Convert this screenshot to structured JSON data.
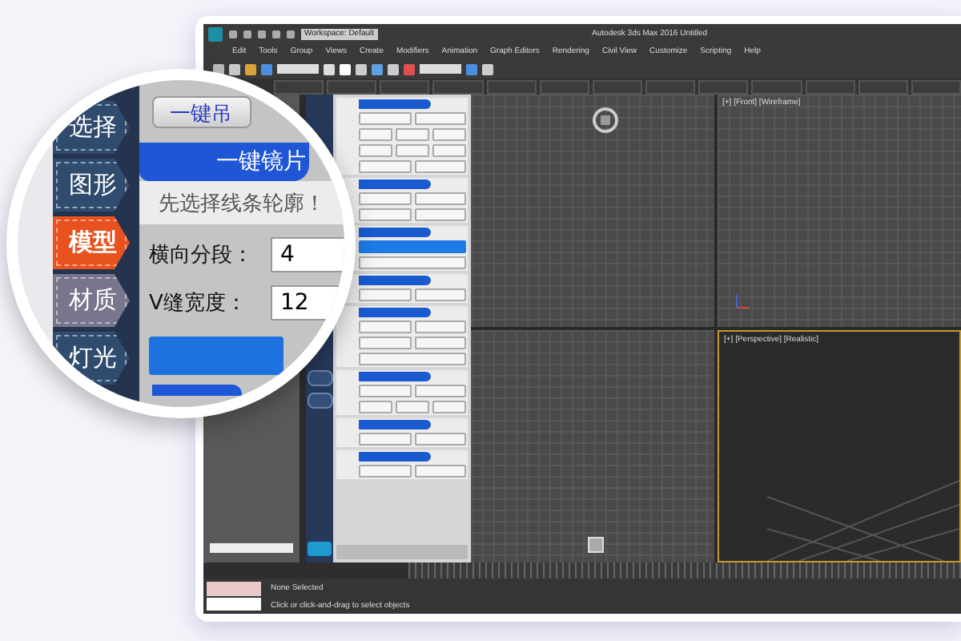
{
  "app_window": {
    "workspace": "Workspace: Default",
    "title": "Autodesk 3ds Max 2016    Untitled",
    "menu": [
      "Edit",
      "Tools",
      "Group",
      "Views",
      "Create",
      "Modifiers",
      "Animation",
      "Graph Editors",
      "Rendering",
      "Civil View",
      "Customize",
      "Scripting",
      "Help"
    ]
  },
  "viewports": [
    {
      "active": false,
      "kind": "gizmo"
    },
    {
      "label": "[+] [Front] [Wireframe]",
      "active": false,
      "kind": "axes"
    },
    {
      "active": false,
      "kind": "cube"
    },
    {
      "label": "[+] [Perspective] [Realistic]",
      "active": true,
      "kind": "floor"
    }
  ],
  "status": {
    "selection": "None Selected",
    "prompt": "Click or click-and-drag to select objects"
  },
  "magnifier": {
    "top_button": "一键吊",
    "tabs": [
      {
        "label": "选择",
        "selected": false,
        "color": "#2f4b6e"
      },
      {
        "label": "图形",
        "selected": false,
        "color": "#2f4b6e"
      },
      {
        "label": "模型",
        "selected": true,
        "color": "#e8521e"
      },
      {
        "label": "材质",
        "selected": false,
        "color": "#77768c"
      },
      {
        "label": "灯光",
        "selected": false,
        "color": "#2f4b6e"
      }
    ],
    "section_title": "一键镜片",
    "hint": "先选择线条轮廓！",
    "fields": [
      {
        "label": "横向分段：",
        "value": "4"
      },
      {
        "label": "V缝宽度：",
        "value": "12"
      }
    ]
  }
}
